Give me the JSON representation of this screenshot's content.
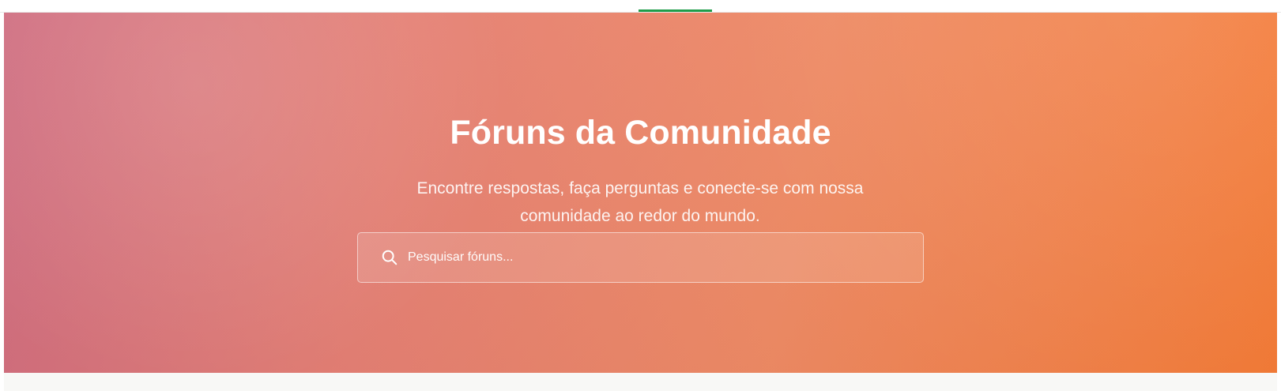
{
  "hero": {
    "title": "Fóruns da Comunidade",
    "subtitle": "Encontre respostas, faça perguntas e conecte-se com nossa comunidade ao redor do mundo."
  },
  "search": {
    "placeholder": "Pesquisar fóruns...",
    "icon": "search-icon"
  },
  "colors": {
    "active_indicator": "#1f9d4a",
    "gradient_start": "#cf6c7f",
    "gradient_end": "#f47a35",
    "hero_text": "#ffffff"
  }
}
